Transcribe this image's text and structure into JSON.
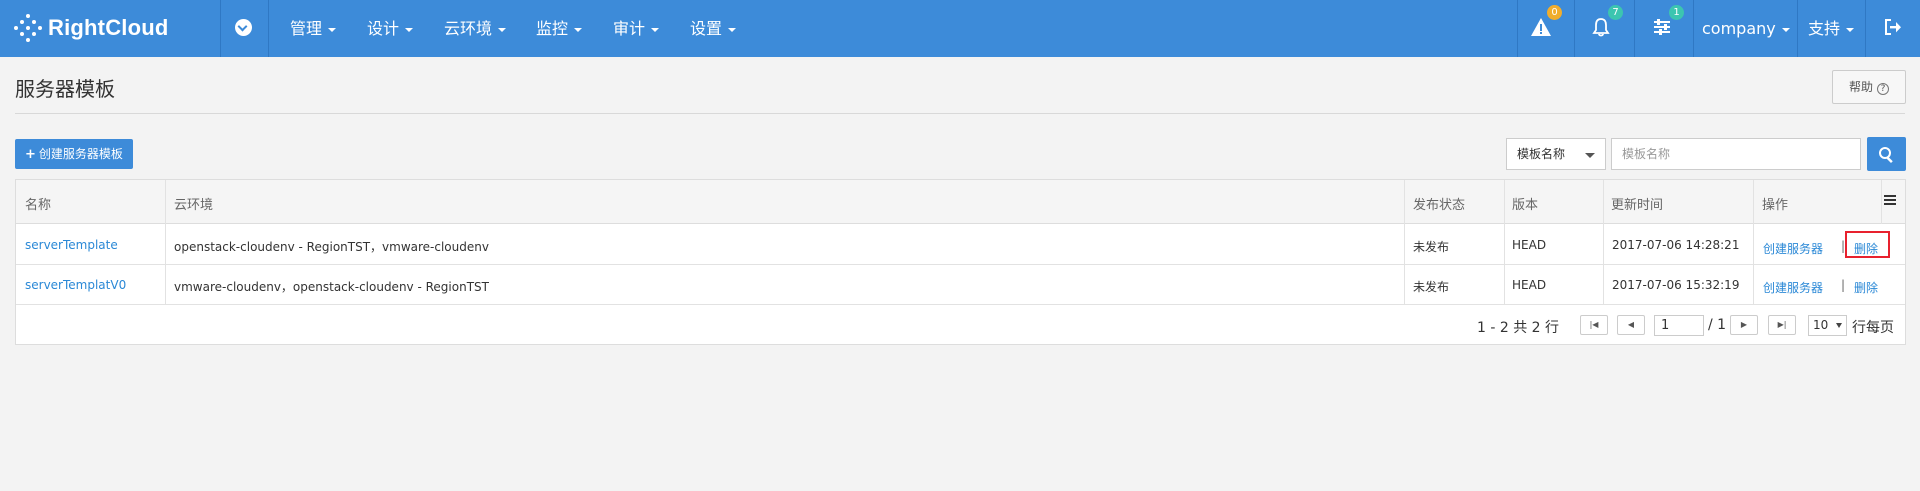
{
  "brand": {
    "name": "RightCloud",
    "color": "#3d8bd9"
  },
  "nav": {
    "menus": [
      "管理",
      "设计",
      "云环境",
      "监控",
      "审计",
      "设置"
    ],
    "alerts": {
      "warning_count": "0",
      "notify_count": "7",
      "settings_count": "1"
    },
    "user": "company",
    "support": "支持"
  },
  "page": {
    "title": "服务器模板",
    "help_label": "帮助",
    "create_button": "创建服务器模板",
    "filter_select": "模板名称",
    "search_placeholder": "模板名称"
  },
  "table": {
    "columns": [
      "名称",
      "云环境",
      "发布状态",
      "版本",
      "更新时间",
      "操作"
    ],
    "rows": [
      {
        "name": "serverTemplate",
        "cloud_env": "openstack-cloudenv - RegionTST，vmware-cloudenv",
        "status": "未发布",
        "version": "HEAD",
        "updated": "2017-07-06 14:28:21",
        "action_create": "创建服务器",
        "action_sep": "|",
        "action_delete": "删除"
      },
      {
        "name": "serverTemplatV0",
        "cloud_env": "vmware-cloudenv，openstack-cloudenv - RegionTST",
        "status": "未发布",
        "version": "HEAD",
        "updated": "2017-07-06 15:32:19",
        "action_create": "创建服务器",
        "action_sep": "|",
        "action_delete": "删除"
      }
    ]
  },
  "pagination": {
    "summary": "1 - 2 共 2 行",
    "current_page": "1",
    "total_pages": "/ 1",
    "page_size": "10",
    "page_size_label": "行每页"
  }
}
